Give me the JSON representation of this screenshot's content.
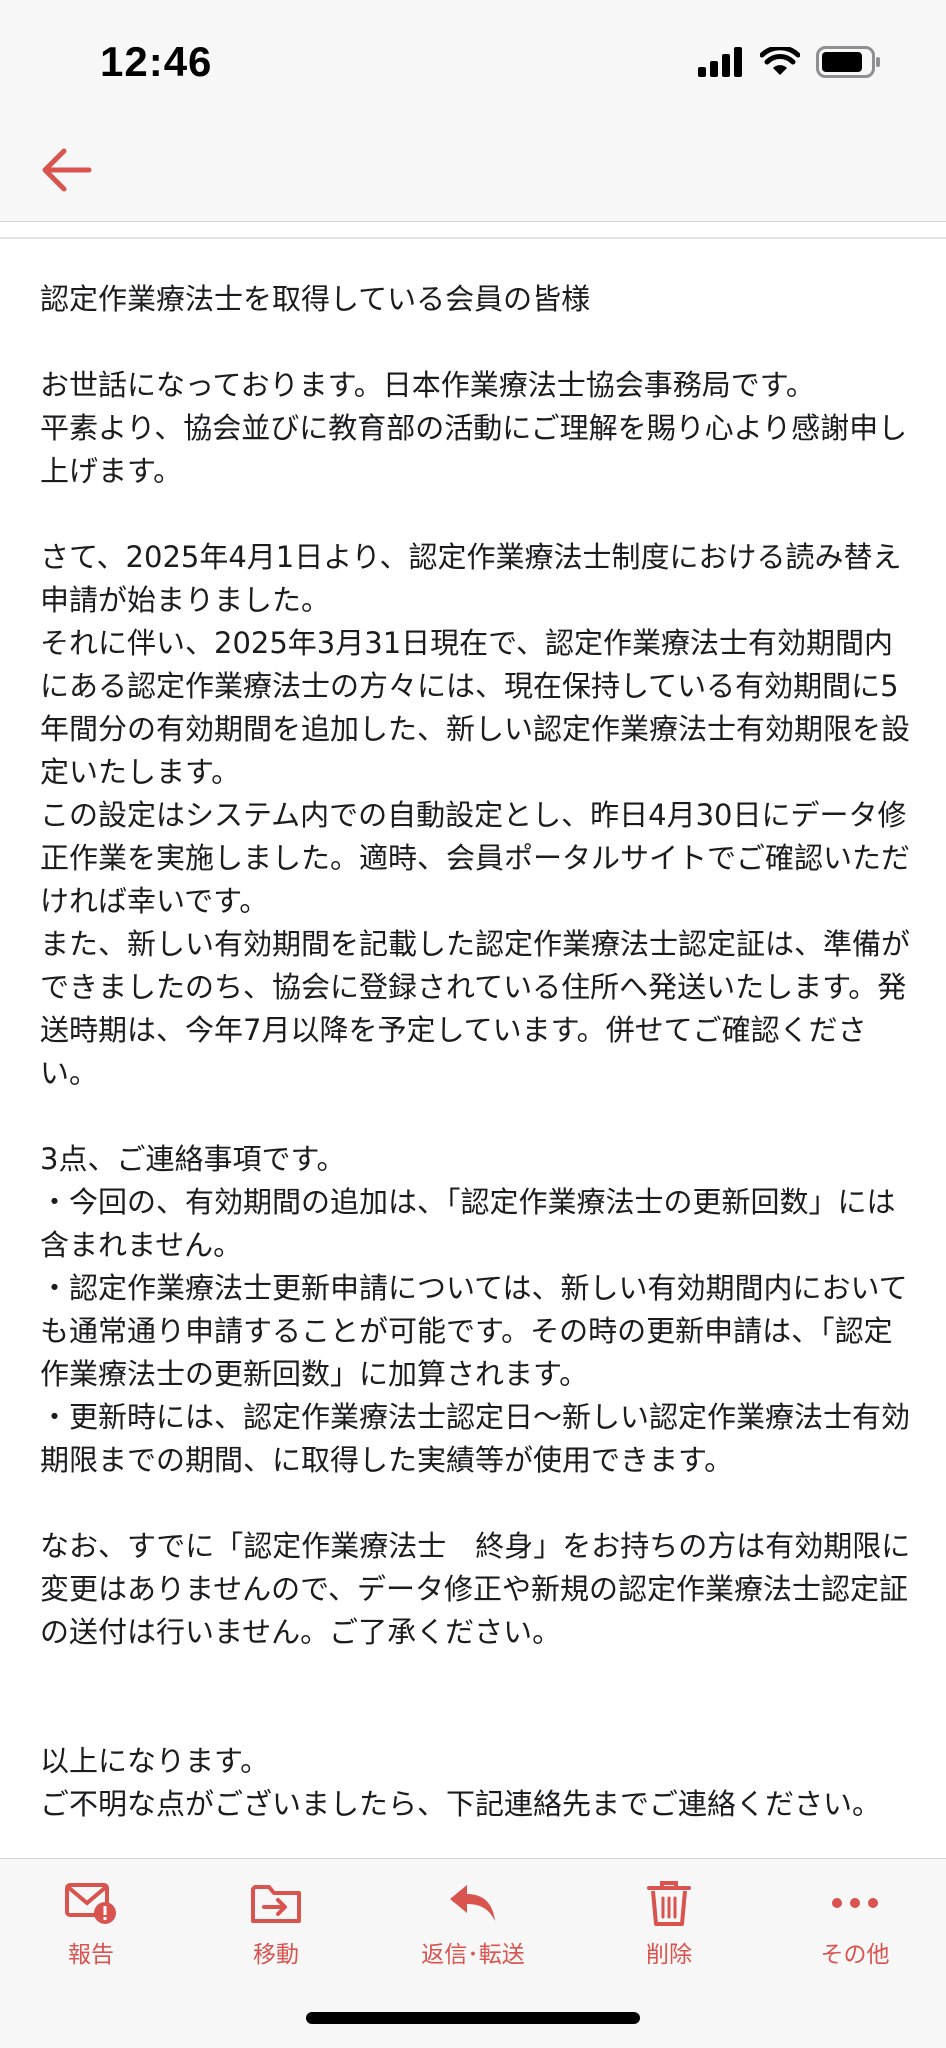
{
  "status_bar": {
    "time": "12:46"
  },
  "colors": {
    "accent": "#d9534f",
    "bar_bg": "#f7f7f7"
  },
  "body": {
    "paragraphs": [
      "認定作業療法士を取得している会員の皆様",
      "お世話になっております。日本作業療法士協会事務局です。\n平素より、協会並びに教育部の活動にご理解を賜り心より感謝申し上げます。",
      "さて、2025年4月1日より、認定作業療法士制度における読み替え申請が始まりました。\nそれに伴い、2025年3月31日現在で、認定作業療法士有効期間内にある認定作業療法士の方々には、現在保持している有効期間に5年間分の有効期間を追加した、新しい認定作業療法士有効期限を設定いたします。\nこの設定はシステム内での自動設定とし、昨日4月30日にデータ修正作業を実施しました。適時、会員ポータルサイトでご確認いただければ幸いです。\nまた、新しい有効期間を記載した認定作業療法士認定証は、準備ができましたのち、協会に登録されている住所へ発送いたします。発送時期は、今年7月以降を予定しています。併せてご確認ください。",
      "3点、ご連絡事項です。\n・今回の、有効期間の追加は、「認定作業療法士の更新回数」には含まれません。\n・認定作業療法士更新申請については、新しい有効期間内においても通常通り申請することが可能です。その時の更新申請は、「認定作業療法士の更新回数」に加算されます。\n・更新時には、認定作業療法士認定日〜新しい認定作業療法士有効期限までの期間、に取得した実績等が使用できます。",
      "なお、すでに「認定作業療法士　終身」をお持ちの方は有効期限に変更はありませんので、データ修正や新規の認定作業療法士認定証の送付は行いません。ご了承ください。",
      "以上になります。\nご不明な点がございましたら、下記連絡先までご連絡ください。"
    ]
  },
  "toolbar": {
    "report": "報告",
    "move": "移動",
    "reply_forward": "返信･転送",
    "delete": "削除",
    "more": "その他"
  }
}
